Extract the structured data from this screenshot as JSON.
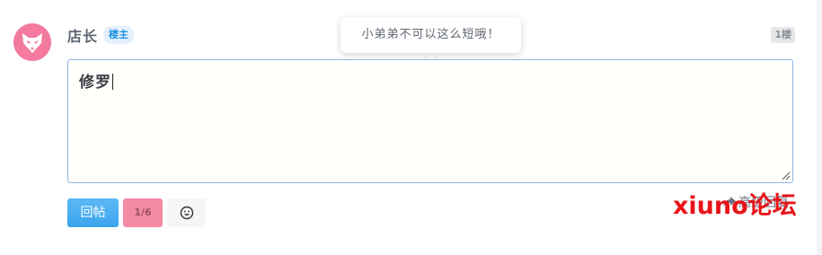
{
  "post": {
    "author_name": "店长",
    "owner_badge": "楼主",
    "floor": "1楼",
    "avatar_icon": "fox-mask-avatar"
  },
  "tooltip": {
    "text": "小弟弟不可以这么短哦！"
  },
  "editor": {
    "value": "修罗"
  },
  "actions": {
    "reply_label": "回帖",
    "page_indicator": "1/6",
    "emoji_icon": "smiley-icon",
    "advanced_icon": "share-forward-icon",
    "advanced_label": "高级回复"
  },
  "watermark": {
    "text": "xiuno论坛"
  },
  "colors": {
    "accent_blue": "#3aa3ec",
    "avatar_pink": "#f47a9f",
    "page_pink": "#f58aa4",
    "watermark_red": "#e8141a",
    "badge_bg": "#e3f1fd",
    "badge_text": "#1e90e0"
  }
}
